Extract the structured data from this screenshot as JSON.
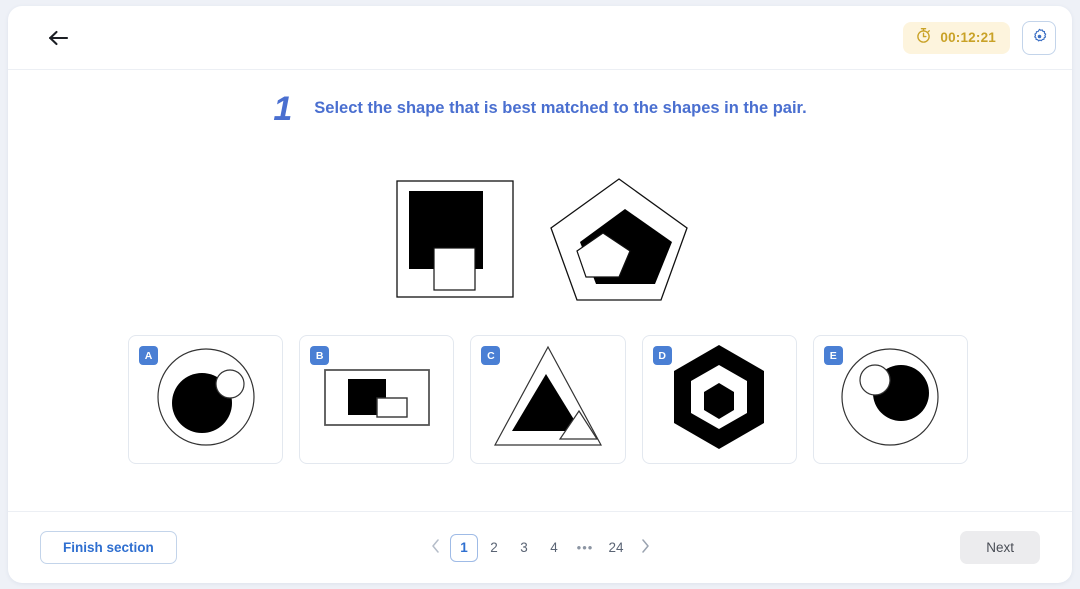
{
  "header": {
    "back_icon": "arrow-left-icon",
    "timer_icon": "stopwatch-icon",
    "timer_value": "00:12:21",
    "settings_icon": "gear-icon",
    "timer_bg": "#fdf4dd",
    "timer_fg": "#c9a227"
  },
  "question": {
    "number": "1",
    "text": "Select the shape that is best matched to the shapes in the pair.",
    "accent_color": "#4a6fd0"
  },
  "stimulus": {
    "figures": [
      {
        "name": "square-with-black-square-and-white-square",
        "description": "Outlined square containing a large black square with a small white square overlapping its bottom edge"
      },
      {
        "name": "pentagon-with-black-pentagon-and-white-pentagon",
        "description": "Outlined pentagon containing a large black pentagon with a small white pentagon overlapping its lower-left"
      }
    ]
  },
  "options": [
    {
      "letter": "A",
      "figure": "circle-with-black-circle-and-small-white-circle-upper-right"
    },
    {
      "letter": "B",
      "figure": "rectangle-with-black-square-and-white-rectangle-lower-right"
    },
    {
      "letter": "C",
      "figure": "triangle-with-black-triangle-and-white-triangle-lower-right"
    },
    {
      "letter": "D",
      "figure": "hexagon-with-white-ring-and-black-inner-hexagon"
    },
    {
      "letter": "E",
      "figure": "circle-with-black-circle-right-and-small-white-circle-upper-left"
    }
  ],
  "option_badge_color": "#4a7fd4",
  "footer": {
    "finish_label": "Finish section",
    "next_label": "Next",
    "prev_icon": "chevron-left-icon",
    "next_icon": "chevron-right-icon",
    "pages": [
      "1",
      "2",
      "3",
      "4"
    ],
    "ellipsis": "•••",
    "last_page": "24",
    "active_page": "1"
  }
}
